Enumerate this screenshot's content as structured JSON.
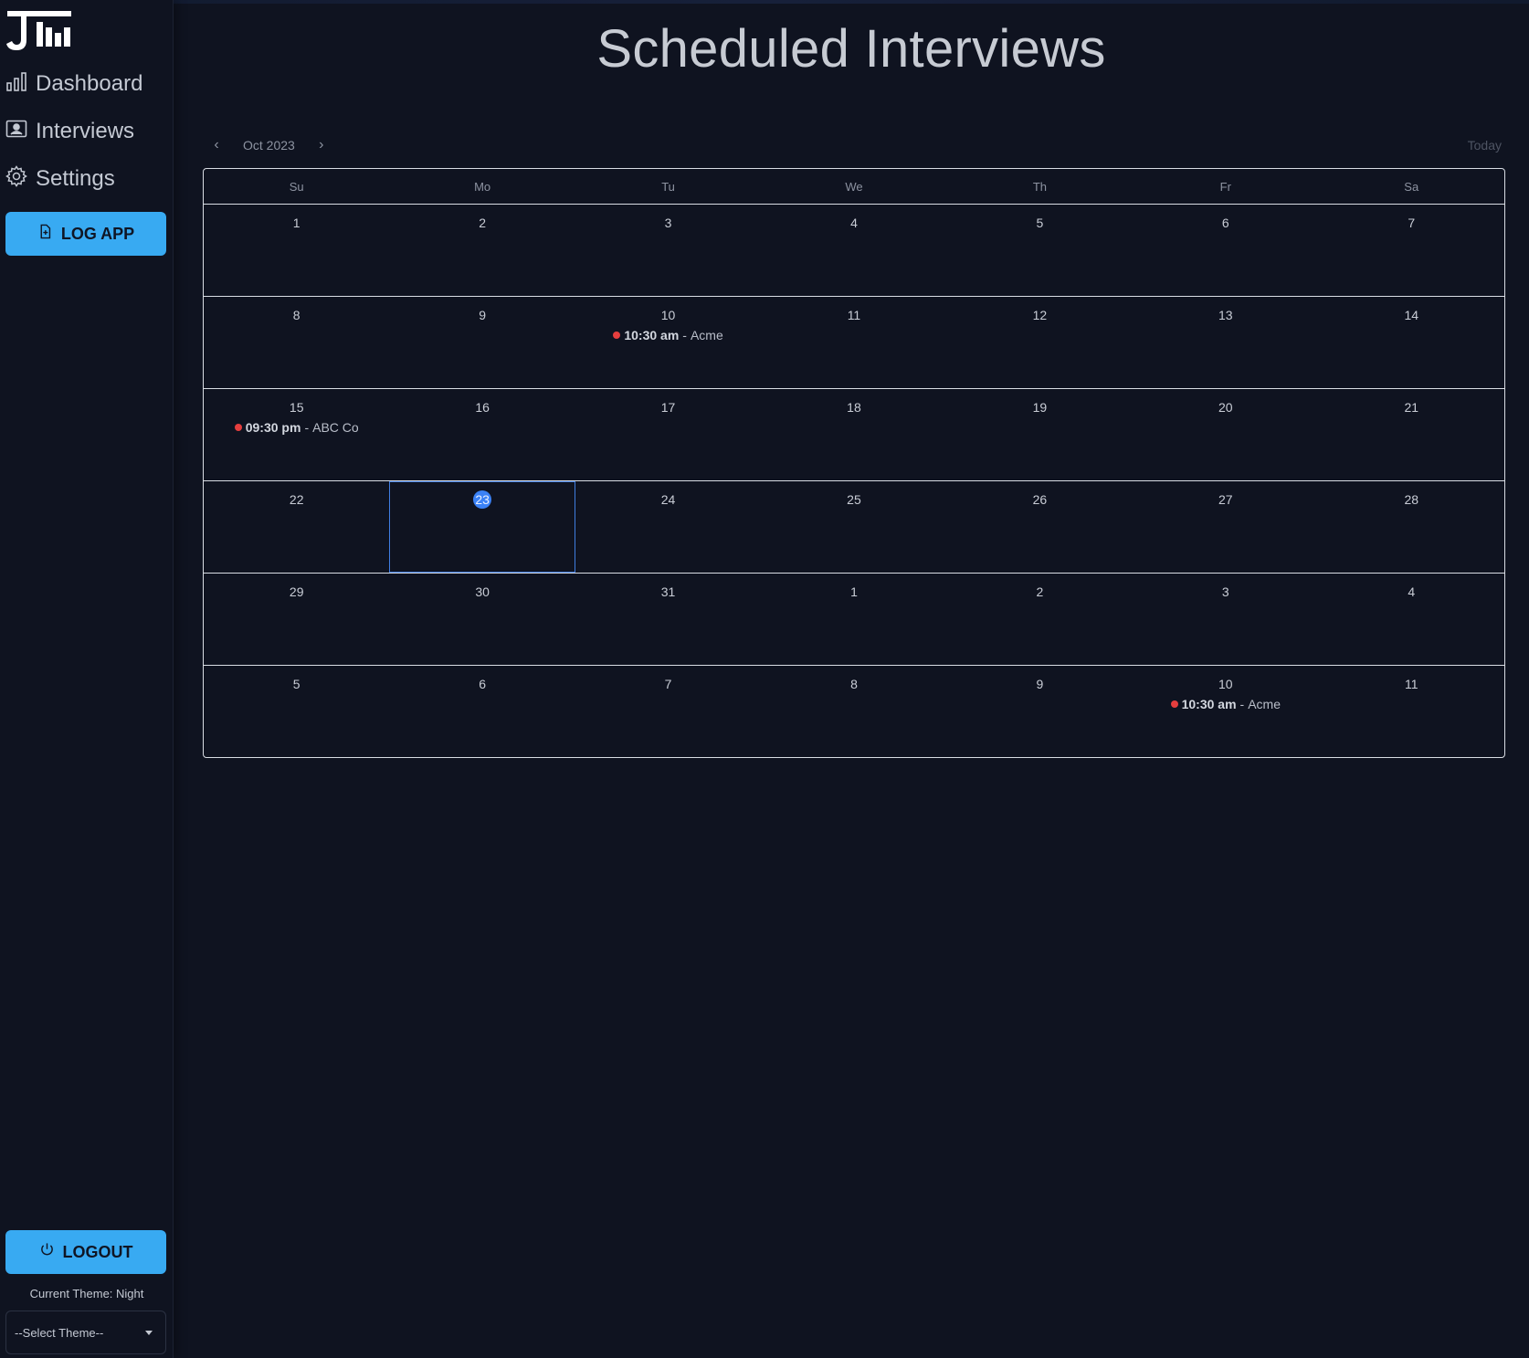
{
  "app": {
    "logo_text": "J",
    "page_title": "Scheduled Interviews"
  },
  "sidebar": {
    "items": [
      {
        "label": "Dashboard",
        "icon": "bar-chart-icon"
      },
      {
        "label": "Interviews",
        "icon": "id-card-icon"
      },
      {
        "label": "Settings",
        "icon": "gear-icon"
      }
    ],
    "log_app_label": "LOG APP",
    "logout_label": "LOGOUT",
    "theme_label": "Current Theme: Night",
    "theme_select_placeholder": "--Select Theme--"
  },
  "calendar": {
    "month_label": "Oct 2023",
    "prev_label": "‹",
    "next_label": "›",
    "today_label": "Today",
    "weekdays": [
      "Su",
      "Mo",
      "Tu",
      "We",
      "Th",
      "Fr",
      "Sa"
    ],
    "weeks": [
      [
        {
          "d": "1"
        },
        {
          "d": "2"
        },
        {
          "d": "3"
        },
        {
          "d": "4"
        },
        {
          "d": "5"
        },
        {
          "d": "6"
        },
        {
          "d": "7"
        }
      ],
      [
        {
          "d": "8"
        },
        {
          "d": "9"
        },
        {
          "d": "10",
          "event": {
            "time": "10:30 am",
            "company": "Acme"
          }
        },
        {
          "d": "11"
        },
        {
          "d": "12"
        },
        {
          "d": "13"
        },
        {
          "d": "14"
        }
      ],
      [
        {
          "d": "15",
          "event": {
            "time": "09:30 pm",
            "company": "ABC Co"
          }
        },
        {
          "d": "16"
        },
        {
          "d": "17"
        },
        {
          "d": "18"
        },
        {
          "d": "19"
        },
        {
          "d": "20"
        },
        {
          "d": "21"
        }
      ],
      [
        {
          "d": "22"
        },
        {
          "d": "23",
          "selected": true
        },
        {
          "d": "24"
        },
        {
          "d": "25"
        },
        {
          "d": "26"
        },
        {
          "d": "27"
        },
        {
          "d": "28"
        }
      ],
      [
        {
          "d": "29"
        },
        {
          "d": "30"
        },
        {
          "d": "31"
        },
        {
          "d": "1"
        },
        {
          "d": "2"
        },
        {
          "d": "3"
        },
        {
          "d": "4"
        }
      ],
      [
        {
          "d": "5"
        },
        {
          "d": "6"
        },
        {
          "d": "7"
        },
        {
          "d": "8"
        },
        {
          "d": "9"
        },
        {
          "d": "10",
          "event": {
            "time": "10:30 am",
            "company": "Acme"
          }
        },
        {
          "d": "11"
        }
      ]
    ],
    "event_separator": "-"
  },
  "colors": {
    "background": "#0f1320",
    "accent": "#38aaf2",
    "selected": "#3b82f6",
    "event_dot": "#e53e3e"
  }
}
